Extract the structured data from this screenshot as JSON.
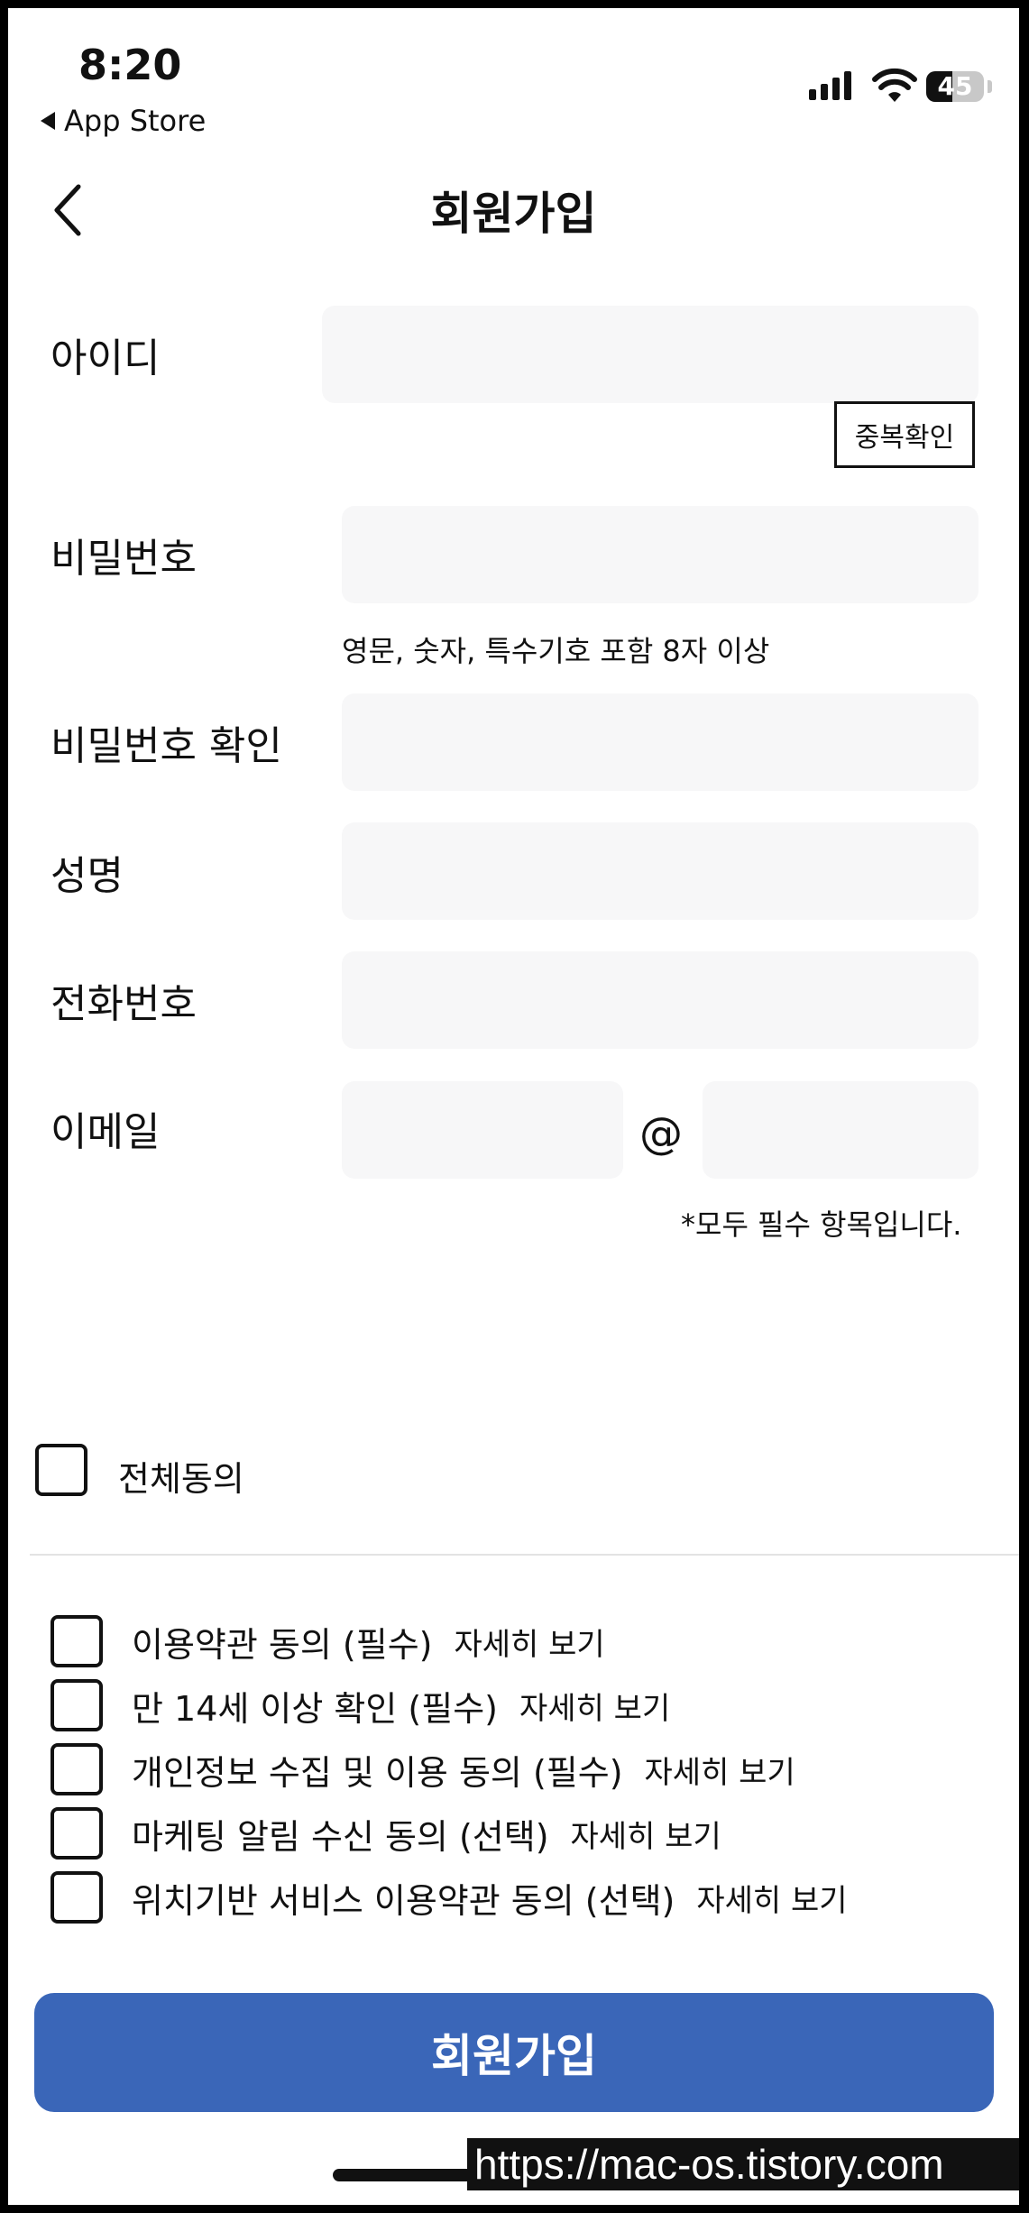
{
  "status_bar": {
    "time": "8:20",
    "back_app": "App Store",
    "battery": "45"
  },
  "header": {
    "title": "회원가입"
  },
  "form": {
    "id_label": "아이디",
    "dup_check": "중복확인",
    "pw_label": "비밀번호",
    "pw_hint": "영문, 숫자, 특수기호 포함 8자 이상",
    "pw_confirm_label": "비밀번호 확인",
    "name_label": "성명",
    "phone_label": "전화번호",
    "email_label": "이메일",
    "email_at": "@",
    "required_note": "*모두 필수 항목입니다."
  },
  "agreements": {
    "all": "전체동의",
    "items": [
      {
        "label": "이용약관 동의 (필수)",
        "link": "자세히 보기"
      },
      {
        "label": "만 14세 이상 확인 (필수)",
        "link": "자세히 보기"
      },
      {
        "label": "개인정보 수집 및 이용 동의 (필수)",
        "link": "자세히 보기"
      },
      {
        "label": "마케팅 알림 수신 동의 (선택)",
        "link": "자세히 보기"
      },
      {
        "label": "위치기반 서비스 이용약관 동의 (선택)",
        "link": "자세히 보기"
      }
    ]
  },
  "submit_label": "회원가입",
  "watermark": "https://mac-os.tistory.com",
  "colors": {
    "primary": "#3a66b8",
    "field_bg": "#f7f7f8"
  }
}
